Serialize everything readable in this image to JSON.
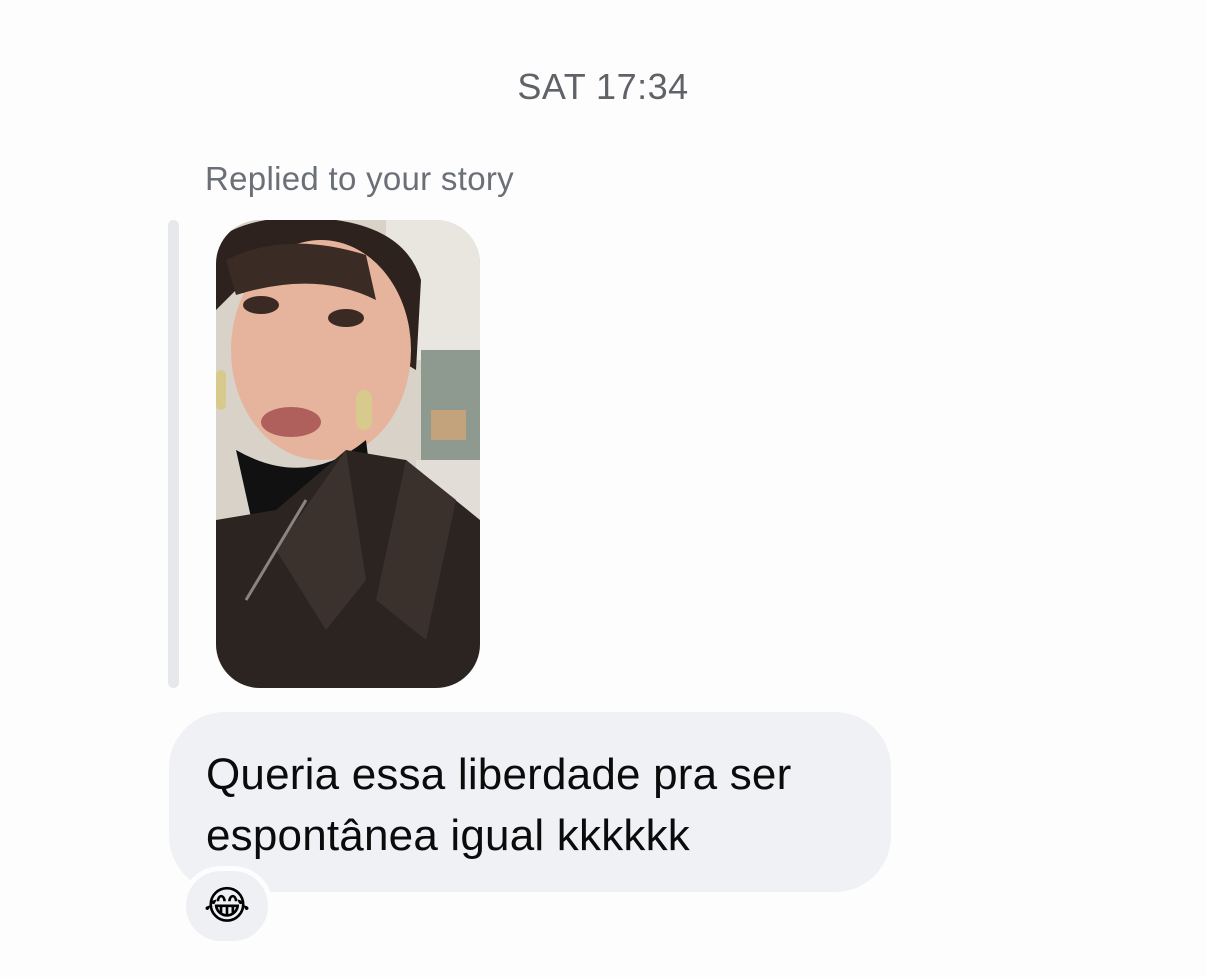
{
  "thread": {
    "timestamp": "SAT 17:34",
    "reply_label": "Replied to your story",
    "story": {
      "description_icon": "story-photo-icon"
    },
    "message": {
      "text": "Queria essa liberdade pra ser espontânea igual kkkkkk"
    },
    "reaction": {
      "emoji": "😂"
    }
  },
  "colors": {
    "background": "#fdfdfe",
    "bubble": "#f0f1f5",
    "secondary_text": "#6b6f76",
    "quote_bar": "#e6e8ec"
  }
}
